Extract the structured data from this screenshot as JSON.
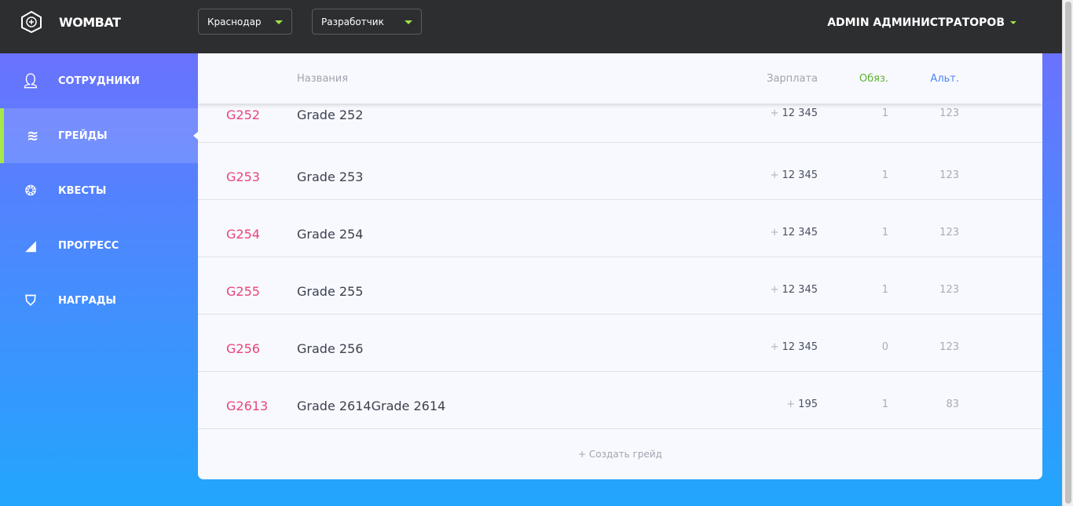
{
  "app": {
    "brand": "WOMBAT",
    "city": "Краснодар",
    "role": "Разработчик",
    "user": "ADMIN АДМИНИСТРАТОРОВ"
  },
  "nav": [
    {
      "label": "СОТРУДНИКИ",
      "icon": "user-icon"
    },
    {
      "label": "ГРЕЙДЫ",
      "icon": "grades-icon"
    },
    {
      "label": "КВЕСТЫ",
      "icon": "medal-icon"
    },
    {
      "label": "ПРОГРЕСС",
      "icon": "progress-icon"
    },
    {
      "label": "НАГРАДЫ",
      "icon": "shield-star-icon"
    }
  ],
  "table": {
    "headers": {
      "name": "Названия",
      "salary": "Зарплата",
      "mandatory": "Обяз.",
      "alt": "Альт."
    },
    "rows": [
      {
        "code": "G252",
        "name": "Grade 252",
        "salary": "12 345",
        "mandatory": "1",
        "alt": "123"
      },
      {
        "code": "G253",
        "name": "Grade 253",
        "salary": "12 345",
        "mandatory": "1",
        "alt": "123"
      },
      {
        "code": "G254",
        "name": "Grade 254",
        "salary": "12 345",
        "mandatory": "1",
        "alt": "123"
      },
      {
        "code": "G255",
        "name": "Grade 255",
        "salary": "12 345",
        "mandatory": "1",
        "alt": "123"
      },
      {
        "code": "G256",
        "name": "Grade 256",
        "salary": "12 345",
        "mandatory": "0",
        "alt": "123"
      },
      {
        "code": "G2613",
        "name": "Grade 2614Grade 2614",
        "salary": "195",
        "mandatory": "1",
        "alt": "83"
      }
    ],
    "plus": "+",
    "create": "+ Создать грейд"
  },
  "colors": {
    "accent_green": "#5db234",
    "accent_blue": "#4a86f5",
    "code": "#e8457a"
  }
}
